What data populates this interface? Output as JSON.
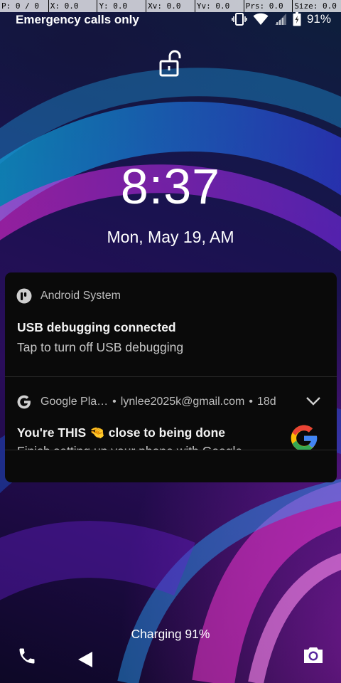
{
  "debug_bar": {
    "p": "P: 0 / 0",
    "x": "X: 0.0",
    "y": "Y: 0.0",
    "xv": "Xv: 0.0",
    "yv": "Yv: 0.0",
    "prs": "Prs: 0.0",
    "size": "Size: 0.0"
  },
  "status_bar": {
    "carrier": "Emergency calls only",
    "battery": "91%",
    "icons": [
      "vibrate-icon",
      "wifi-icon",
      "signal-icon",
      "battery-icon"
    ]
  },
  "lockscreen": {
    "lock_icon": "unlock-icon",
    "time": "8:37",
    "date": "Mon, May 19, AM"
  },
  "notifications": [
    {
      "app": "Android System",
      "icon": "android-system-icon",
      "title": "USB debugging connected",
      "text": "Tap to turn off USB debugging"
    },
    {
      "app": "Google Pla…",
      "account": "lynlee2025k@gmail.com",
      "age": "18d",
      "icon": "google-g-icon",
      "title": "You're THIS 🤏 close to being done",
      "text": "Finish setting up your phone with Google"
    }
  ],
  "bottom": {
    "charging": "Charging 91%",
    "left_icon": "phone-icon",
    "right_icon": "camera-icon"
  },
  "colors": {
    "notification_bg": "#0a0a0a",
    "google_blue": "#4285F4",
    "google_red": "#EA4335",
    "google_yellow": "#FBBC05",
    "google_green": "#34A853"
  }
}
